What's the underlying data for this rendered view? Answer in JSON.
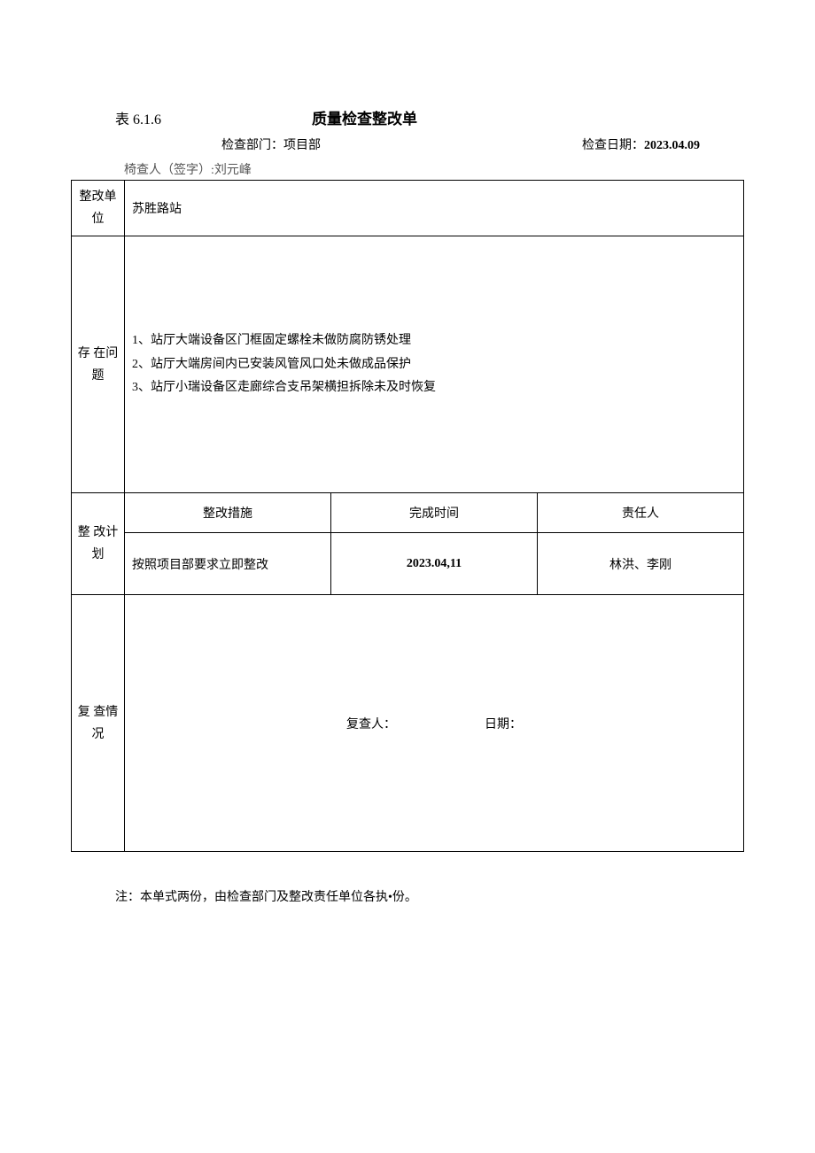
{
  "header": {
    "tableNumber": "表 6.1.6",
    "title": "质量检查整改单",
    "deptLabel": "检查部门：",
    "deptValue": "项目部",
    "dateLabel": "检查日期：",
    "dateValue": "2023.04.09",
    "inspectorLabel": "椅查人（签字）:",
    "inspectorValue": "刘元峰"
  },
  "labels": {
    "unit": "整改单位",
    "problems": "存 在问题",
    "plan": "整 改计 划",
    "measure": "整改措施",
    "completeTime": "完成时间",
    "responsible": "责任人",
    "review": "复 查情 况",
    "reviewer": "复查人：",
    "reviewDate": "日期："
  },
  "unit": "苏胜路站",
  "problems": {
    "p1": "1、站厅大端设备区门框固定螺栓未做防腐防锈处理",
    "p2": "2、站厅大端房间内已安装风管风口处未做成品保护",
    "p3": "3、站厅小瑞设备区走廊综合支吊架横担拆除未及时恢复"
  },
  "plan": {
    "measure": "按照项目部要求立即整改",
    "completeTime": "2023.04,11",
    "responsible": "林洪、李刚"
  },
  "note": "注：本单式两份，由检查部门及整改责任单位各执•份。"
}
